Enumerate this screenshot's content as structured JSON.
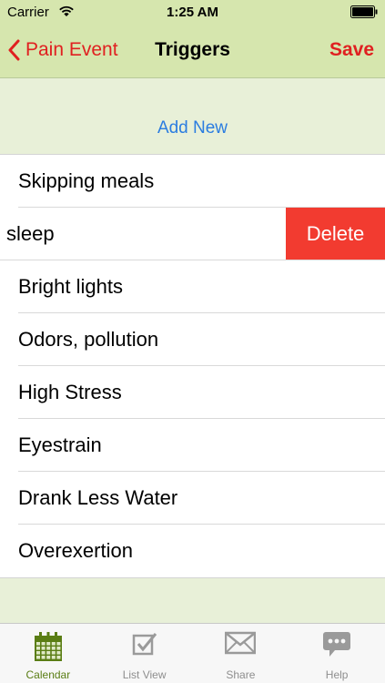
{
  "status_bar": {
    "carrier": "Carrier",
    "time": "1:25 AM"
  },
  "nav": {
    "back_label": "Pain Event",
    "title": "Triggers",
    "save_label": "Save"
  },
  "add_new_label": "Add New",
  "triggers": [
    {
      "label": "Skipping meals"
    },
    {
      "label": "sleep",
      "swiped": true
    },
    {
      "label": "Bright lights"
    },
    {
      "label": "Odors, pollution"
    },
    {
      "label": "High Stress"
    },
    {
      "label": "Eyestrain"
    },
    {
      "label": "Drank Less Water"
    },
    {
      "label": "Overexertion"
    }
  ],
  "delete_label": "Delete",
  "tabs": [
    {
      "label": "Calendar",
      "icon": "calendar-icon",
      "active": true
    },
    {
      "label": "List View",
      "icon": "checklist-icon",
      "active": false
    },
    {
      "label": "Share",
      "icon": "envelope-icon",
      "active": false
    },
    {
      "label": "Help",
      "icon": "speech-bubble-icon",
      "active": false
    }
  ],
  "colors": {
    "nav_bg": "#d6e6ae",
    "accent_red": "#e02020",
    "link_blue": "#2b7de0",
    "delete_red": "#f23b30",
    "tab_active": "#5a7d14"
  }
}
